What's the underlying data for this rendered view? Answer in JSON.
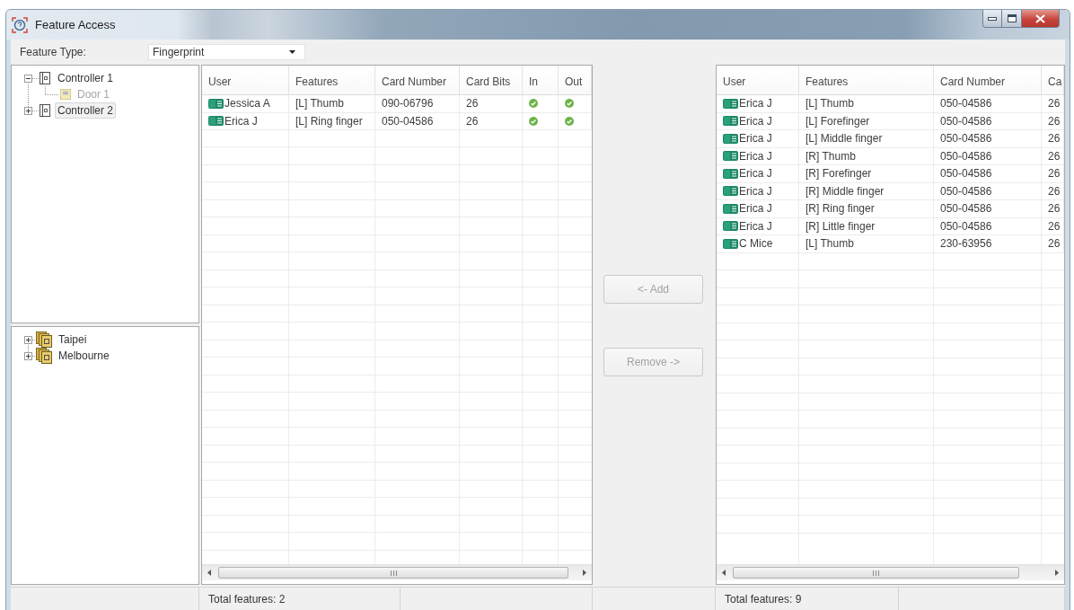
{
  "window": {
    "title": "Feature Access"
  },
  "feature_type": {
    "label": "Feature Type:",
    "value": "Fingerprint"
  },
  "controller_tree": [
    {
      "kind": "controller",
      "label": "Controller 1",
      "expanded": true,
      "selected": false,
      "children": [
        {
          "kind": "door",
          "label": "Door 1",
          "disabled": true,
          "selected": false
        }
      ]
    },
    {
      "kind": "controller",
      "label": "Controller 2",
      "expanded": false,
      "selected": true
    }
  ],
  "site_tree": [
    {
      "kind": "site",
      "label": "Taipei",
      "expanded": false,
      "selected": false
    },
    {
      "kind": "site",
      "label": "Melbourne",
      "expanded": false,
      "selected": false
    }
  ],
  "assigned_table": {
    "columns": [
      "User",
      "Features",
      "Card Number",
      "Card Bits",
      "In",
      "Out"
    ],
    "rows": [
      {
        "user": "Jessica A",
        "feature": "[L] Thumb",
        "card_number": "090-06796",
        "card_bits": "26",
        "in": true,
        "out": true
      },
      {
        "user": "Erica J",
        "feature": "[L] Ring finger",
        "card_number": "050-04586",
        "card_bits": "26",
        "in": true,
        "out": true
      }
    ]
  },
  "actions": [
    {
      "label": "<- Add",
      "disabled": true
    },
    {
      "label": "Remove ->",
      "disabled": true
    }
  ],
  "available_table": {
    "columns": [
      "User",
      "Features",
      "Card Number",
      "Ca"
    ],
    "rows": [
      {
        "user": "Erica J",
        "feature": "[L] Thumb",
        "card_number": "050-04586",
        "column_4": "26"
      },
      {
        "user": "Erica J",
        "feature": "[L] Forefinger",
        "card_number": "050-04586",
        "column_4": "26"
      },
      {
        "user": "Erica J",
        "feature": "[L] Middle finger",
        "card_number": "050-04586",
        "column_4": "26"
      },
      {
        "user": "Erica J",
        "feature": "[R] Thumb",
        "card_number": "050-04586",
        "column_4": "26"
      },
      {
        "user": "Erica J",
        "feature": "[R] Forefinger",
        "card_number": "050-04586",
        "column_4": "26"
      },
      {
        "user": "Erica J",
        "feature": "[R] Middle finger",
        "card_number": "050-04586",
        "column_4": "26"
      },
      {
        "user": "Erica J",
        "feature": "[R] Ring finger",
        "card_number": "050-04586",
        "column_4": "26"
      },
      {
        "user": "Erica J",
        "feature": "[R] Little finger",
        "card_number": "050-04586",
        "column_4": "26"
      },
      {
        "user": "C Mice",
        "feature": "[L] Thumb",
        "card_number": "230-63956",
        "column_4": "26"
      }
    ]
  },
  "status_bar": {
    "assigned_total": "Total features: 2",
    "available_total": "Total features: 9"
  }
}
